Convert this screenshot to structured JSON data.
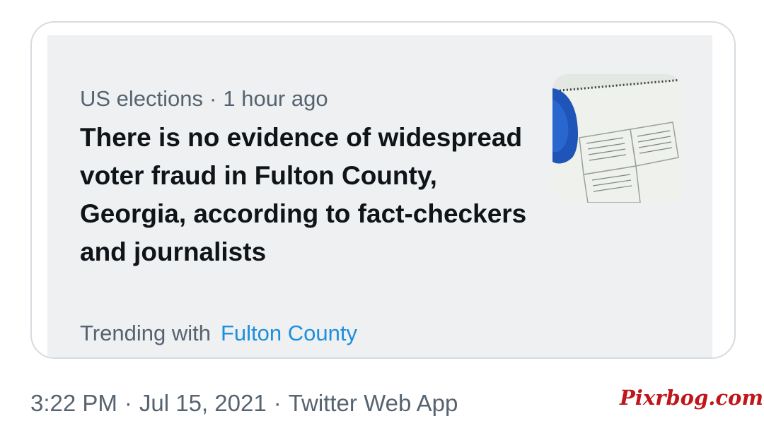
{
  "card": {
    "category": "US elections",
    "separator": "·",
    "time_ago": "1 hour ago",
    "headline": "There is no evidence of widespread voter fraud in Fulton County, Georgia, according to fact-checkers and journalists",
    "trending_label": "Trending with",
    "trending_topic": "Fulton County",
    "image": "ballot-photo"
  },
  "footer": {
    "time": "3:22 PM",
    "separator": "·",
    "date": "Jul 15, 2021",
    "source": "Twitter Web App"
  },
  "watermark": {
    "text": "Pixrbog.com"
  },
  "colors": {
    "secondary_text": "#566370",
    "primary_text": "#0f1419",
    "link": "#1d8fdc",
    "card_background": "#eef0f1",
    "card_border": "#d5dbe0",
    "watermark": "#c0151a"
  }
}
